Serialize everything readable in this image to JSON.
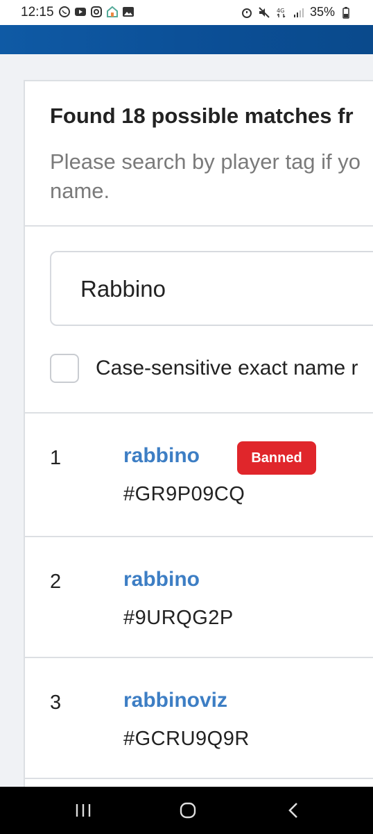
{
  "status_bar": {
    "time": "12:15",
    "battery": "35%",
    "icons_left": [
      "whatsapp-icon",
      "youtube-icon",
      "instagram-icon",
      "home-app-icon",
      "gallery-icon"
    ],
    "icons_right": [
      "alarm-icon",
      "mute-icon",
      "4g-icon",
      "signal-icon",
      "battery-icon"
    ]
  },
  "header": {
    "color": "#0f5aa5"
  },
  "results": {
    "title": "Found 18 possible matches fr",
    "subtitle_line1": "Please search by player tag if yo",
    "subtitle_line2": "name."
  },
  "search": {
    "value": "Rabbino"
  },
  "exact_match": {
    "label": "Case-sensitive exact name r",
    "checked": false
  },
  "rows": [
    {
      "index": "1",
      "name": "rabbino",
      "tag": "#GR9P09CQ",
      "badge": "Banned"
    },
    {
      "index": "2",
      "name": "rabbino",
      "tag": "#9URQG2P"
    },
    {
      "index": "3",
      "name": "rabbinoviz",
      "tag": "#GCRU9Q9R"
    }
  ],
  "colors": {
    "link": "#3d7ec4",
    "banned": "#e0262b"
  },
  "nav": {
    "recents": "recents-icon",
    "home": "home-icon",
    "back": "back-icon"
  }
}
